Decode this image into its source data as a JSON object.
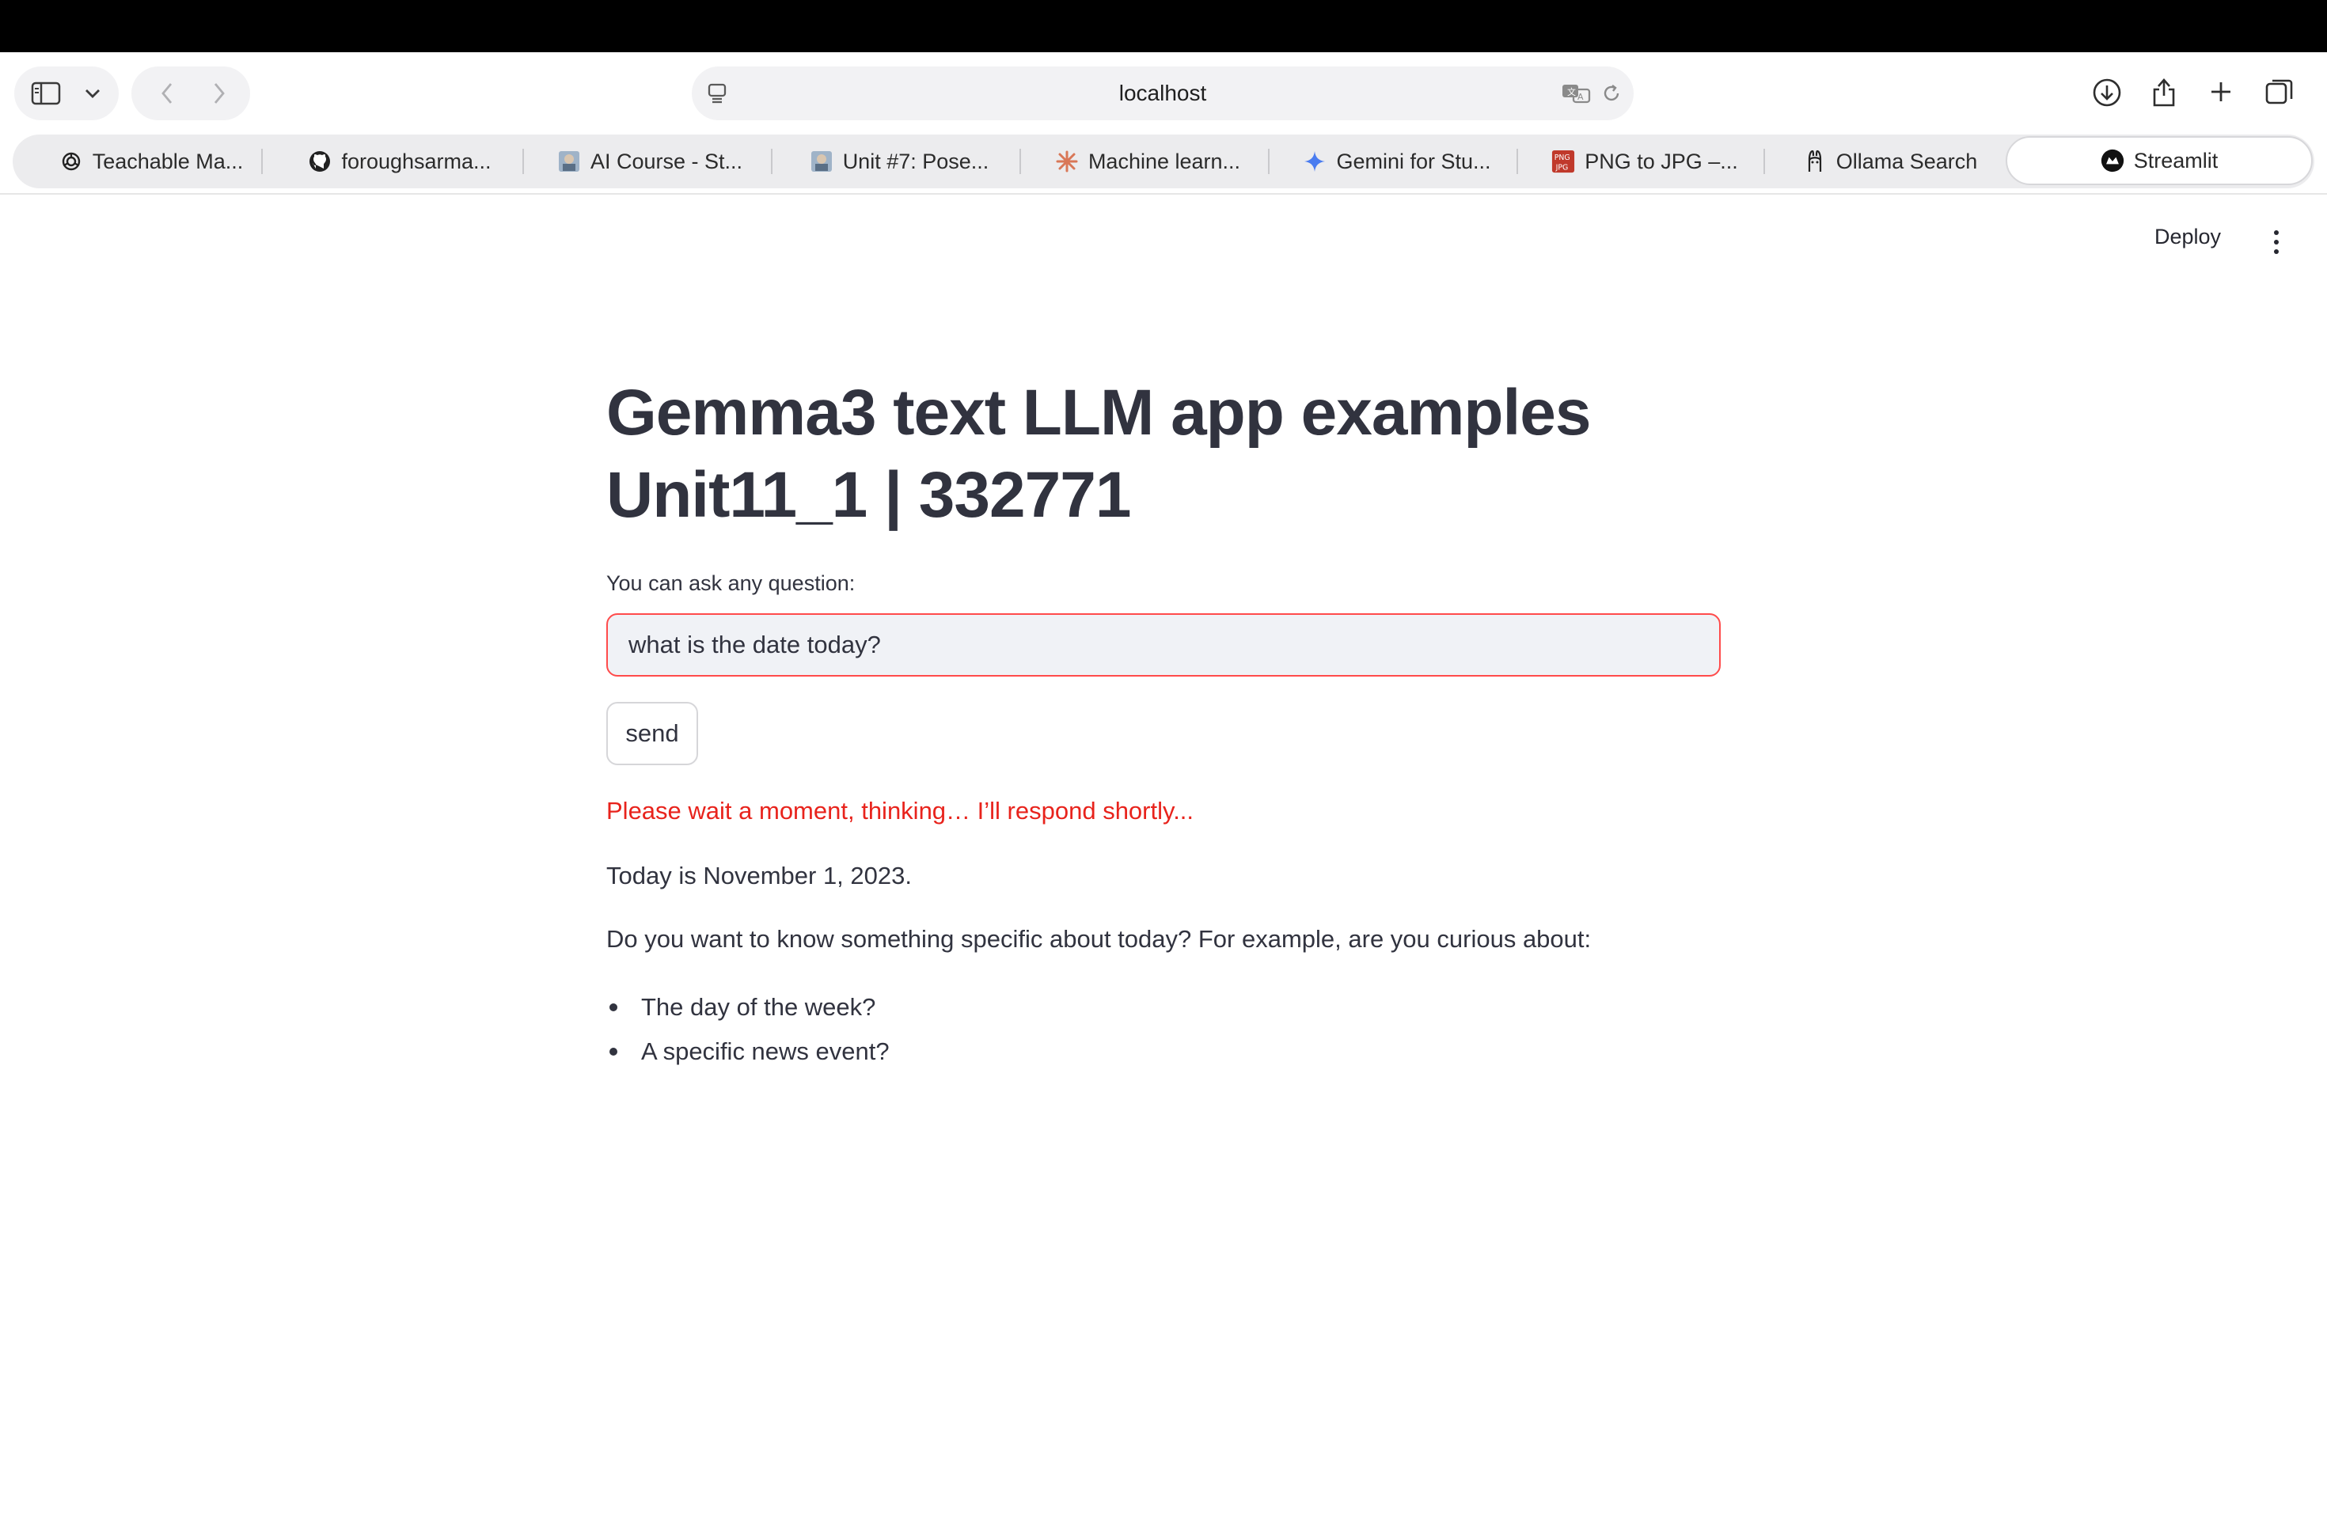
{
  "browser": {
    "address": "localhost",
    "tabs": [
      {
        "label": "Teachable Ma...",
        "icon": "openai-icon"
      },
      {
        "label": "foroughsarma...",
        "icon": "github-icon"
      },
      {
        "label": "AI Course - St...",
        "icon": "course-thumbnail-icon"
      },
      {
        "label": "Unit #7: Pose...",
        "icon": "course-thumbnail-icon"
      },
      {
        "label": "Machine learn...",
        "icon": "starburst-icon"
      },
      {
        "label": "Gemini for Stu...",
        "icon": "gemini-sparkle-icon"
      },
      {
        "label": "PNG to JPG –...",
        "icon": "png-jpg-icon"
      },
      {
        "label": "Ollama Search",
        "icon": "ollama-icon"
      },
      {
        "label": "Streamlit",
        "icon": "streamlit-icon"
      }
    ],
    "active_tab": "Streamlit"
  },
  "app_header": {
    "deploy_label": "Deploy"
  },
  "main": {
    "title_line1": "Gemma3 text LLM app examples",
    "title_line2": "Unit11_1 | 332771",
    "question_label": "You can ask any question:",
    "question_value": "what is the date today?",
    "send_label": "send",
    "wait_message": "Please wait a moment, thinking… I’ll respond shortly...",
    "answer": "Today is November 1, 2023.",
    "followup": "Do you want to know something specific about today? For example, are you curious about:",
    "bullets": [
      "The day of the week?",
      "A specific news event?"
    ]
  },
  "colors": {
    "accent_red": "#ff4b4b",
    "warning_text": "#e8231c",
    "text": "#31333f"
  }
}
